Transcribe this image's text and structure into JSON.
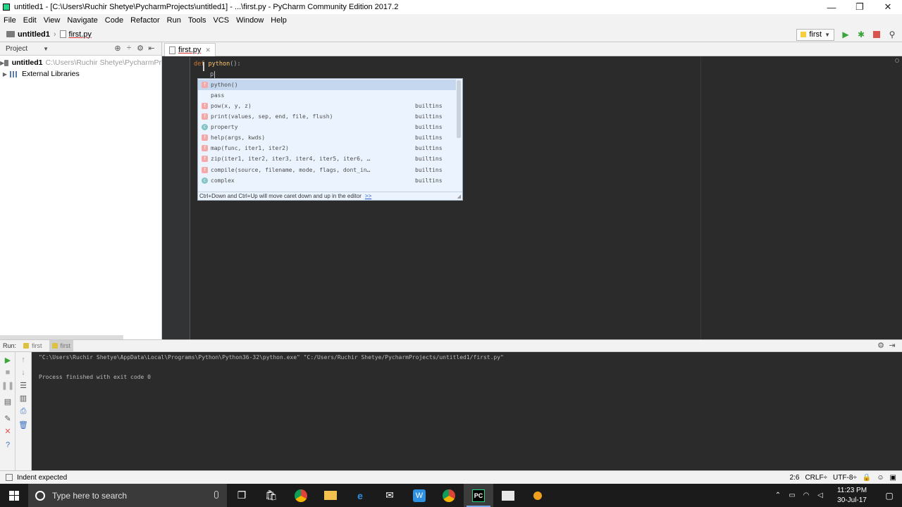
{
  "window": {
    "title": "untitled1 - [C:\\Users\\Ruchir Shetye\\PycharmProjects\\untitled1] - ...\\first.py - PyCharm Community Edition 2017.2",
    "minimize": "—",
    "maximize": "❐",
    "close": "✕"
  },
  "menu": [
    "File",
    "Edit",
    "View",
    "Navigate",
    "Code",
    "Refactor",
    "Run",
    "Tools",
    "VCS",
    "Window",
    "Help"
  ],
  "navbar": {
    "project": "untitled1",
    "file": "first.py",
    "run_config": "first"
  },
  "project_panel": {
    "title": "Project",
    "tree": [
      {
        "name": "untitled1",
        "path": "C:\\Users\\Ruchir Shetye\\PycharmPr"
      },
      {
        "name": "External Libraries"
      }
    ]
  },
  "editor": {
    "tab": "first.py",
    "code": {
      "keyword": "def",
      "function": "python",
      "suffix": "():",
      "line2": "p"
    }
  },
  "completion": {
    "items": [
      {
        "icon": "f",
        "label": "python()",
        "source": "",
        "selected": true
      },
      {
        "icon": "k",
        "label": "pass",
        "source": ""
      },
      {
        "icon": "f",
        "label": "pow(x, y, z)",
        "source": "builtins"
      },
      {
        "icon": "f",
        "label": "print(values, sep, end, file, flush)",
        "source": "builtins"
      },
      {
        "icon": "c",
        "label": "property",
        "source": "builtins"
      },
      {
        "icon": "f",
        "label": "help(args, kwds)",
        "source": "builtins"
      },
      {
        "icon": "f",
        "label": "map(func, iter1, iter2)",
        "source": "builtins"
      },
      {
        "icon": "f",
        "label": "zip(iter1, iter2, iter3, iter4, iter5, iter6, …",
        "source": "builtins"
      },
      {
        "icon": "f",
        "label": "compile(source, filename, mode, flags, dont_in…",
        "source": "builtins"
      },
      {
        "icon": "c",
        "label": "complex",
        "source": "builtins"
      }
    ],
    "hint": "Ctrl+Down and Ctrl+Up will move caret down and up in the editor",
    "hint_link": ">>"
  },
  "run": {
    "label": "Run:",
    "tabs": [
      "first",
      "first"
    ],
    "lines": [
      "\"C:\\Users\\Ruchir Shetye\\AppData\\Local\\Programs\\Python\\Python36-32\\python.exe\" \"C:/Users/Ruchir Shetye/PycharmProjects/untitled1/first.py\"",
      "Process finished with exit code 0"
    ]
  },
  "status": {
    "message": "Indent expected",
    "position": "2:6",
    "line_sep": "CRLF÷",
    "encoding": "UTF-8÷"
  },
  "taskbar": {
    "search_placeholder": "Type here to search",
    "time": "11:23 PM",
    "date": "30-Jul-17"
  }
}
